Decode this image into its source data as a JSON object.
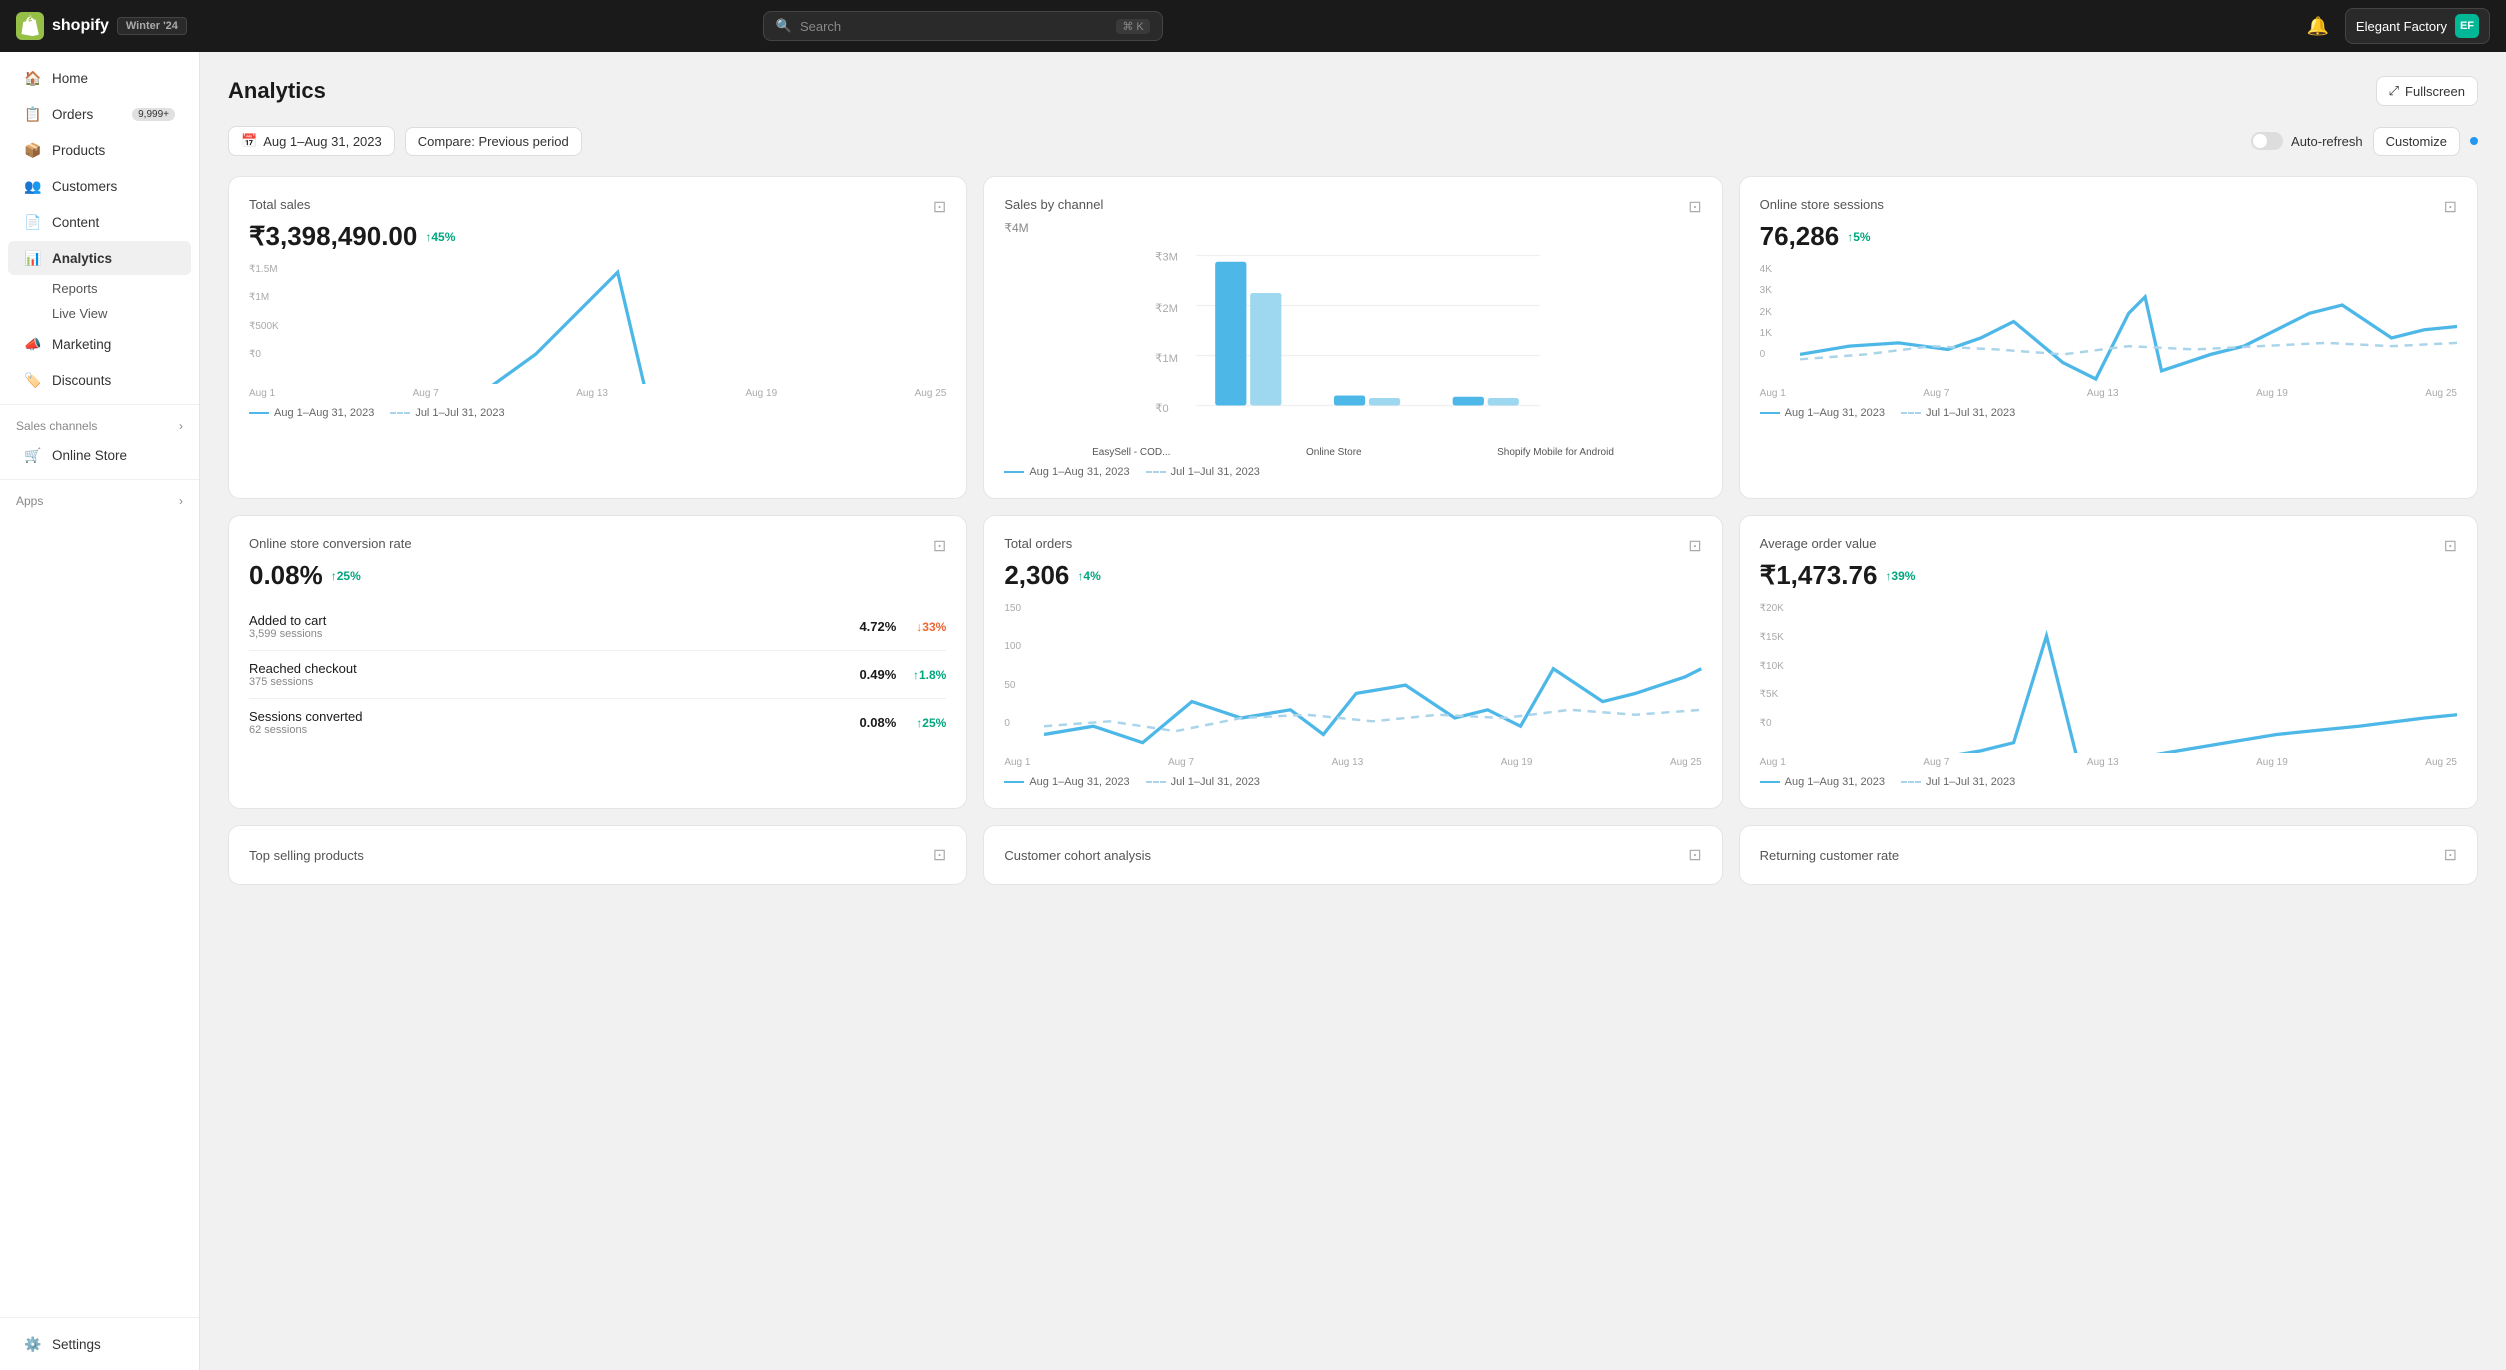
{
  "topbar": {
    "logo_text": "shopify",
    "winter_badge": "Winter '24",
    "search_placeholder": "Search",
    "search_shortcut": "⌘ K",
    "store_name": "Elegant Factory",
    "store_initials": "EF"
  },
  "sidebar": {
    "items": [
      {
        "id": "home",
        "label": "Home",
        "icon": "🏠",
        "active": false
      },
      {
        "id": "orders",
        "label": "Orders",
        "icon": "📋",
        "badge": "9,999+",
        "active": false
      },
      {
        "id": "products",
        "label": "Products",
        "icon": "📦",
        "active": false
      },
      {
        "id": "customers",
        "label": "Customers",
        "icon": "👥",
        "active": false
      },
      {
        "id": "content",
        "label": "Content",
        "icon": "📄",
        "active": false
      },
      {
        "id": "analytics",
        "label": "Analytics",
        "icon": "📊",
        "active": true
      },
      {
        "id": "reports",
        "label": "Reports",
        "sub": true,
        "active": false
      },
      {
        "id": "live-view",
        "label": "Live View",
        "sub": true,
        "active": false
      },
      {
        "id": "marketing",
        "label": "Marketing",
        "icon": "📣",
        "active": false
      },
      {
        "id": "discounts",
        "label": "Discounts",
        "icon": "🏷️",
        "active": false
      }
    ],
    "sales_channels": "Sales channels",
    "online_store": "Online Store",
    "apps": "Apps",
    "settings": "Settings"
  },
  "page": {
    "title": "Analytics",
    "fullscreen_label": "Fullscreen",
    "date_range": "Aug 1–Aug 31, 2023",
    "compare": "Compare: Previous period",
    "auto_refresh": "Auto-refresh",
    "customize": "Customize"
  },
  "cards": {
    "total_sales": {
      "title": "Total sales",
      "value": "₹3,398,490.00",
      "trend": "↑45%",
      "trend_up": true,
      "y_labels": [
        "₹1.5M",
        "₹1M",
        "₹500K",
        "₹0"
      ],
      "x_labels": [
        "Aug 1",
        "Aug 7",
        "Aug 13",
        "Aug 19",
        "Aug 25"
      ],
      "legend_current": "Aug 1–Aug 31, 2023",
      "legend_prev": "Jul 1–Jul 31, 2023"
    },
    "sales_by_channel": {
      "title": "Sales by channel",
      "subtitle": "₹4M",
      "channels": [
        "EasySell - COD...",
        "Online Store",
        "Shopify Mobile for Android"
      ],
      "y_labels": [
        "₹3M",
        "₹2M",
        "₹1M",
        "₹0"
      ],
      "legend_current": "Aug 1–Aug 31, 2023",
      "legend_prev": "Jul 1–Jul 31, 2023"
    },
    "online_sessions": {
      "title": "Online store sessions",
      "value": "76,286",
      "trend": "↑5%",
      "trend_up": true,
      "y_labels": [
        "4K",
        "3K",
        "2K",
        "1K",
        "0"
      ],
      "x_labels": [
        "Aug 1",
        "Aug 7",
        "Aug 13",
        "Aug 19",
        "Aug 25"
      ],
      "legend_current": "Aug 1–Aug 31, 2023",
      "legend_prev": "Jul 1–Jul 31, 2023"
    },
    "conversion": {
      "title": "Online store conversion rate",
      "value": "0.08%",
      "trend": "↑25%",
      "trend_up": true,
      "rows": [
        {
          "label": "Added to cart",
          "sublabel": "3,599 sessions",
          "val": "4.72%",
          "trend": "↓33%",
          "up": false
        },
        {
          "label": "Reached checkout",
          "sublabel": "375 sessions",
          "val": "0.49%",
          "trend": "↑1.8%",
          "up": true
        },
        {
          "label": "Sessions converted",
          "sublabel": "62 sessions",
          "val": "0.08%",
          "trend": "↑25%",
          "up": true
        }
      ]
    },
    "total_orders": {
      "title": "Total orders",
      "value": "2,306",
      "trend": "↑4%",
      "trend_up": true,
      "y_labels": [
        "150",
        "100",
        "50",
        "0"
      ],
      "x_labels": [
        "Aug 1",
        "Aug 7",
        "Aug 13",
        "Aug 19",
        "Aug 25"
      ],
      "legend_current": "Aug 1–Aug 31, 2023",
      "legend_prev": "Jul 1–Jul 31, 2023"
    },
    "avg_order": {
      "title": "Average order value",
      "value": "₹1,473.76",
      "trend": "↑39%",
      "trend_up": true,
      "y_labels": [
        "₹20K",
        "₹15K",
        "₹10K",
        "₹5K",
        "₹0"
      ],
      "x_labels": [
        "Aug 1",
        "Aug 7",
        "Aug 13",
        "Aug 19",
        "Aug 25"
      ],
      "legend_current": "Aug 1–Aug 31, 2023",
      "legend_prev": "Jul 1–Jul 31, 2023"
    }
  },
  "bottom_cards": {
    "top_selling": "Top selling products",
    "cohort": "Customer cohort analysis",
    "returning": "Returning customer rate"
  }
}
